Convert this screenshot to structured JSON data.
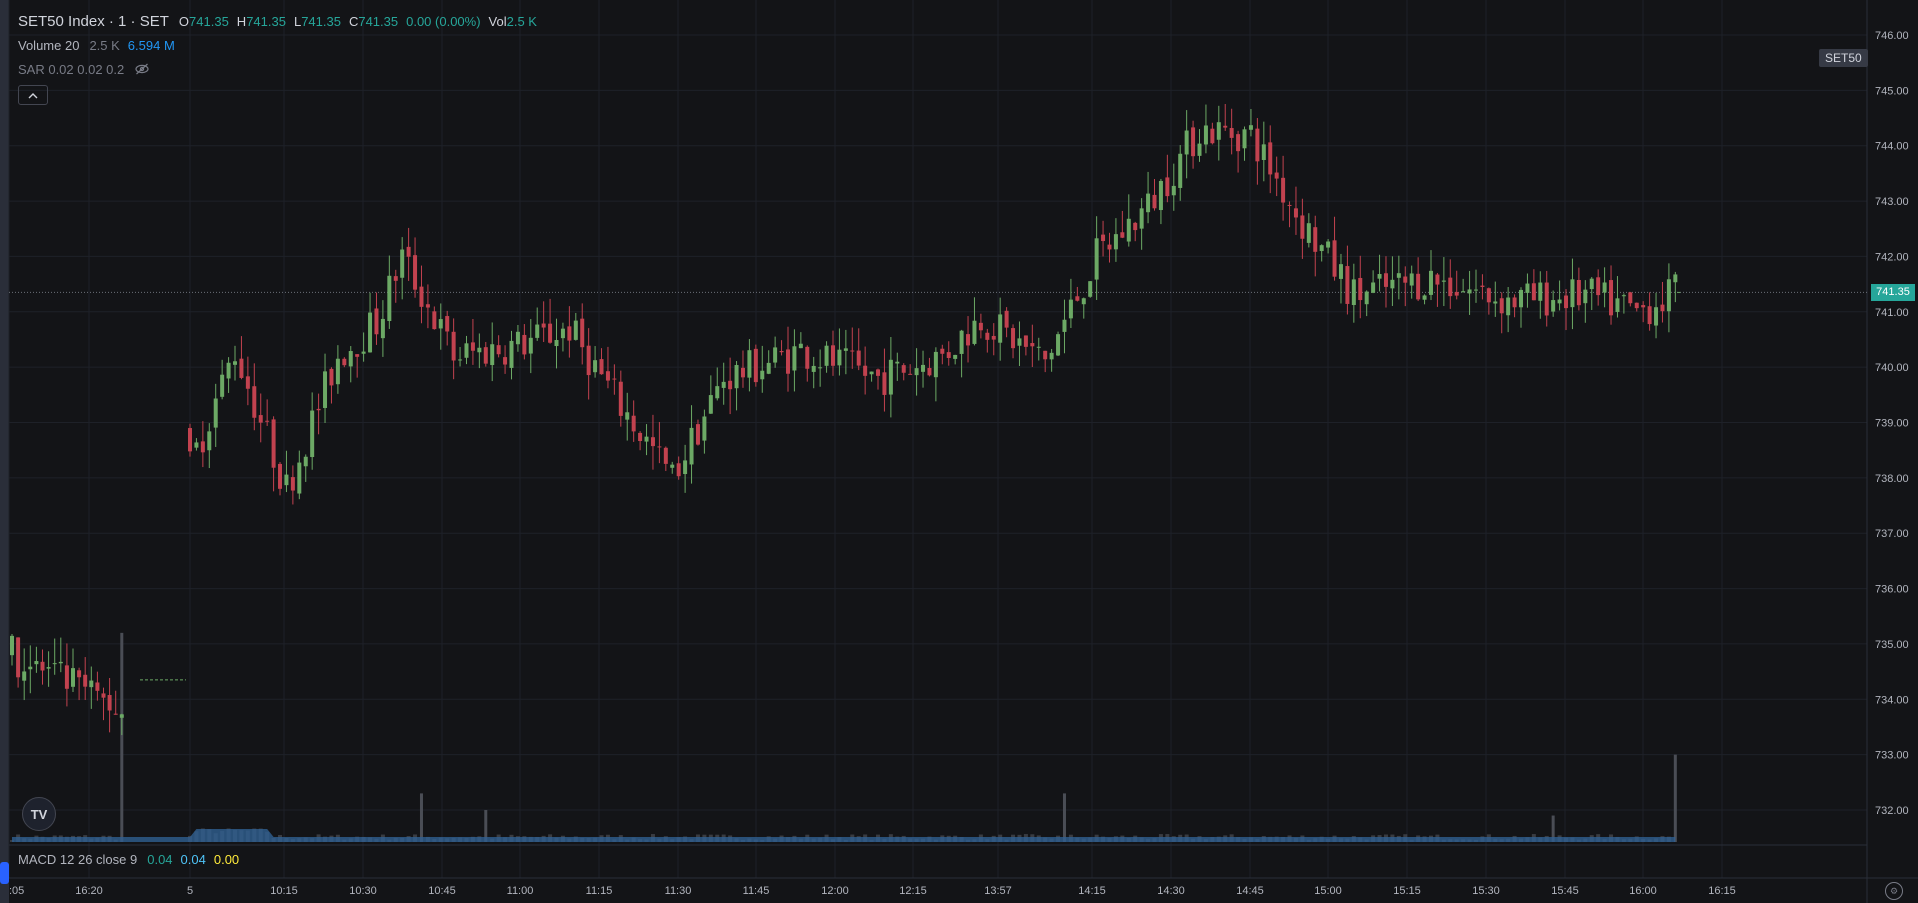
{
  "legend": {
    "title": "SET50 Index · 1 · SET",
    "ohlc": [
      {
        "k": "O",
        "v": "741.35"
      },
      {
        "k": "H",
        "v": "741.35"
      },
      {
        "k": "L",
        "v": "741.35"
      },
      {
        "k": "C",
        "v": "741.35"
      },
      {
        "k": "",
        "v": "0.00 (0.00%)"
      }
    ],
    "vol_label": "Vol",
    "vol_value": "2.5 K",
    "volume_name": "Volume 20",
    "volume_v1": "2.5 K",
    "volume_v2": "6.594 M",
    "sar_name": "SAR 0.02 0.02 0.2",
    "collapse_glyph": "^",
    "hidden_icon": "eye-off-icon"
  },
  "macd": {
    "name": "MACD 12 26 close 9",
    "v1": "0.04",
    "v2": "0.04",
    "v3": "0.00"
  },
  "symbol_tag": "SET50",
  "last_price_tag": "741.35",
  "logo_text": "TV",
  "colors": {
    "up": "#26a69a",
    "up_candle": "#6ca965",
    "down_candle": "#c2424f",
    "volume": "#2f5f91",
    "macd_v1": "#26a69a",
    "macd_v2": "#4fc3f7",
    "macd_v3": "#ffeb3b",
    "vol2": "#2196f3"
  },
  "chart_data": {
    "type": "candlestick",
    "y_ticks": [
      "746.00",
      "745.00",
      "744.00",
      "743.00",
      "742.00",
      "741.00",
      "740.00",
      "739.00",
      "738.00",
      "737.00",
      "736.00",
      "735.00",
      "734.00",
      "733.00",
      "732.00"
    ],
    "ylim": [
      731.4,
      746.5
    ],
    "x_ticks": [
      ":05",
      "16:20",
      "5",
      "10:15",
      "10:30",
      "10:45",
      "11:00",
      "11:15",
      "11:30",
      "11:45",
      "12:00",
      "12:15",
      "13:57",
      "14:15",
      "14:30",
      "14:45",
      "15:00",
      "15:15",
      "15:30",
      "15:45",
      "16:00",
      "16:15"
    ],
    "last_price": 741.35,
    "prev_close": 734.35,
    "waypoints": [
      [
        0,
        734.8
      ],
      [
        18,
        733.8
      ],
      [
        20,
        734.4
      ],
      [
        21,
        738.2
      ],
      [
        28,
        740.3
      ],
      [
        36,
        737.8
      ],
      [
        44,
        740.2
      ],
      [
        50,
        740.8
      ],
      [
        54,
        742.0
      ],
      [
        62,
        740.2
      ],
      [
        72,
        740.4
      ],
      [
        80,
        740.7
      ],
      [
        88,
        739.3
      ],
      [
        96,
        738.0
      ],
      [
        104,
        739.8
      ],
      [
        116,
        740.3
      ],
      [
        128,
        739.8
      ],
      [
        138,
        740.2
      ],
      [
        144,
        740.9
      ],
      [
        154,
        740.1
      ],
      [
        162,
        742.0
      ],
      [
        170,
        742.9
      ],
      [
        178,
        744.3
      ],
      [
        186,
        744.2
      ],
      [
        194,
        742.6
      ],
      [
        202,
        741.3
      ],
      [
        214,
        741.6
      ],
      [
        226,
        741.2
      ],
      [
        238,
        741.3
      ],
      [
        246,
        741.0
      ],
      [
        252,
        741.35
      ]
    ],
    "candle_count": 253,
    "volume_spikes": [
      [
        18,
        735.2
      ],
      [
        57,
        732.3
      ],
      [
        67,
        732.0
      ],
      [
        157,
        732.3
      ],
      [
        233,
        731.9
      ],
      [
        252,
        733.0
      ]
    ]
  }
}
